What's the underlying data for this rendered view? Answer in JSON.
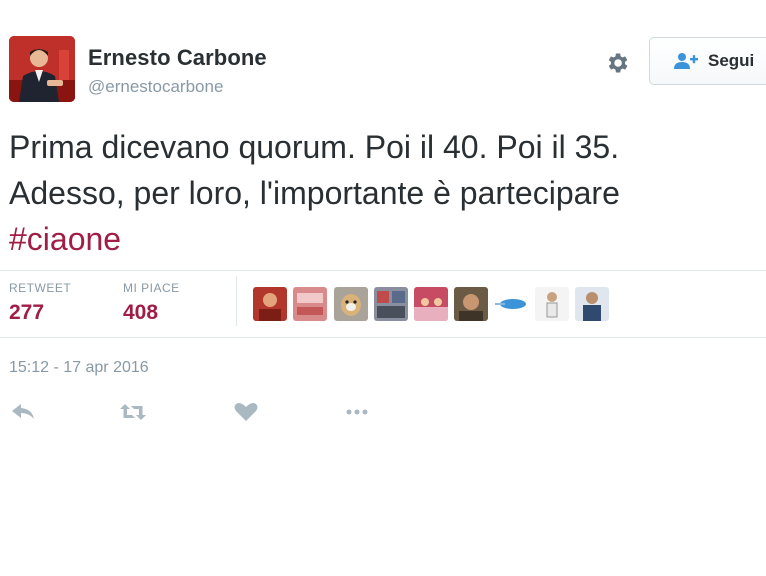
{
  "author": {
    "display_name": "Ernesto Carbone",
    "screen_name": "@ernestocarbone"
  },
  "header": {
    "settings_icon": "gear-icon",
    "follow_icon": "add-user-icon",
    "follow_label": "Segui"
  },
  "tweet": {
    "text_lines": [
      "Prima dicevano quorum. Poi il 40. Poi il 35.",
      "Adesso, per loro, l'importante è partecipare"
    ],
    "hashtag": "#ciaone"
  },
  "stats": {
    "retweet_label": "RETWEET",
    "retweet_count": "277",
    "likes_label": "MI PIACE",
    "likes_count": "408"
  },
  "timestamp": "15:12 - 17 apr 2016",
  "actions": [
    {
      "icon": "reply-icon"
    },
    {
      "icon": "retweet-icon"
    },
    {
      "icon": "heart-icon"
    },
    {
      "icon": "more-icon"
    }
  ],
  "colors": {
    "hashtag": "#a01e46",
    "count": "#a01e46",
    "muted": "#8899a6",
    "text": "#292f33",
    "divider": "#e1e8ed"
  }
}
